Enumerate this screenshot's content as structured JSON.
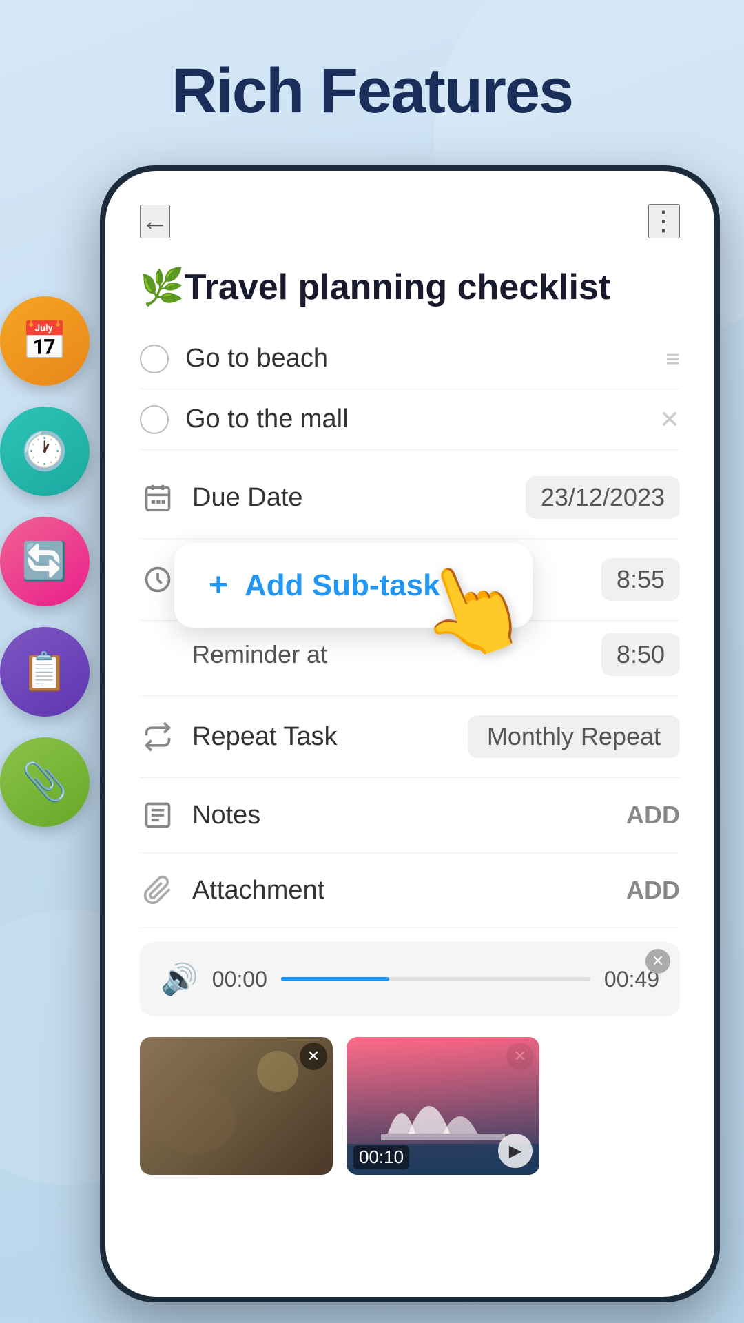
{
  "page": {
    "title": "Rich Features",
    "background_color": "#cce3f5"
  },
  "side_icons": [
    {
      "id": "calendar",
      "color_class": "icon-orange",
      "emoji": "📅",
      "label": "calendar-icon"
    },
    {
      "id": "clock",
      "color_class": "icon-teal",
      "emoji": "🕐",
      "label": "clock-icon"
    },
    {
      "id": "repeat",
      "color_class": "icon-pink",
      "emoji": "🔄",
      "label": "repeat-icon"
    },
    {
      "id": "notes",
      "color_class": "icon-purple",
      "emoji": "📋",
      "label": "notes-icon"
    },
    {
      "id": "attachment",
      "color_class": "icon-green",
      "emoji": "📎",
      "label": "attachment-icon"
    }
  ],
  "app": {
    "task_title": "🌿Travel planning checklist",
    "back_button": "←",
    "more_button": "⋮",
    "tasks": [
      {
        "text": "Go to beach",
        "checked": false
      },
      {
        "text": "Go to the mall",
        "checked": false
      }
    ],
    "add_subtask_label": "Add Sub-task",
    "details": {
      "due_date": {
        "label": "Due Date",
        "value": "23/12/2023"
      },
      "time_reminder": {
        "label": "Time & Reminder",
        "value": "8:55"
      },
      "reminder_at": {
        "label": "Reminder at",
        "value": "8:50"
      },
      "repeat_task": {
        "label": "Repeat Task",
        "value": "Monthly Repeat"
      },
      "notes": {
        "label": "Notes",
        "action": "ADD"
      },
      "attachment": {
        "label": "Attachment",
        "action": "ADD"
      }
    },
    "audio": {
      "start_time": "00:00",
      "end_time": "00:49",
      "progress_percent": 35
    },
    "media": [
      {
        "type": "photo",
        "bg_class": "thumb-bg-1"
      },
      {
        "type": "video",
        "bg_class": "thumb-bg-2",
        "duration": "00:10"
      }
    ]
  }
}
